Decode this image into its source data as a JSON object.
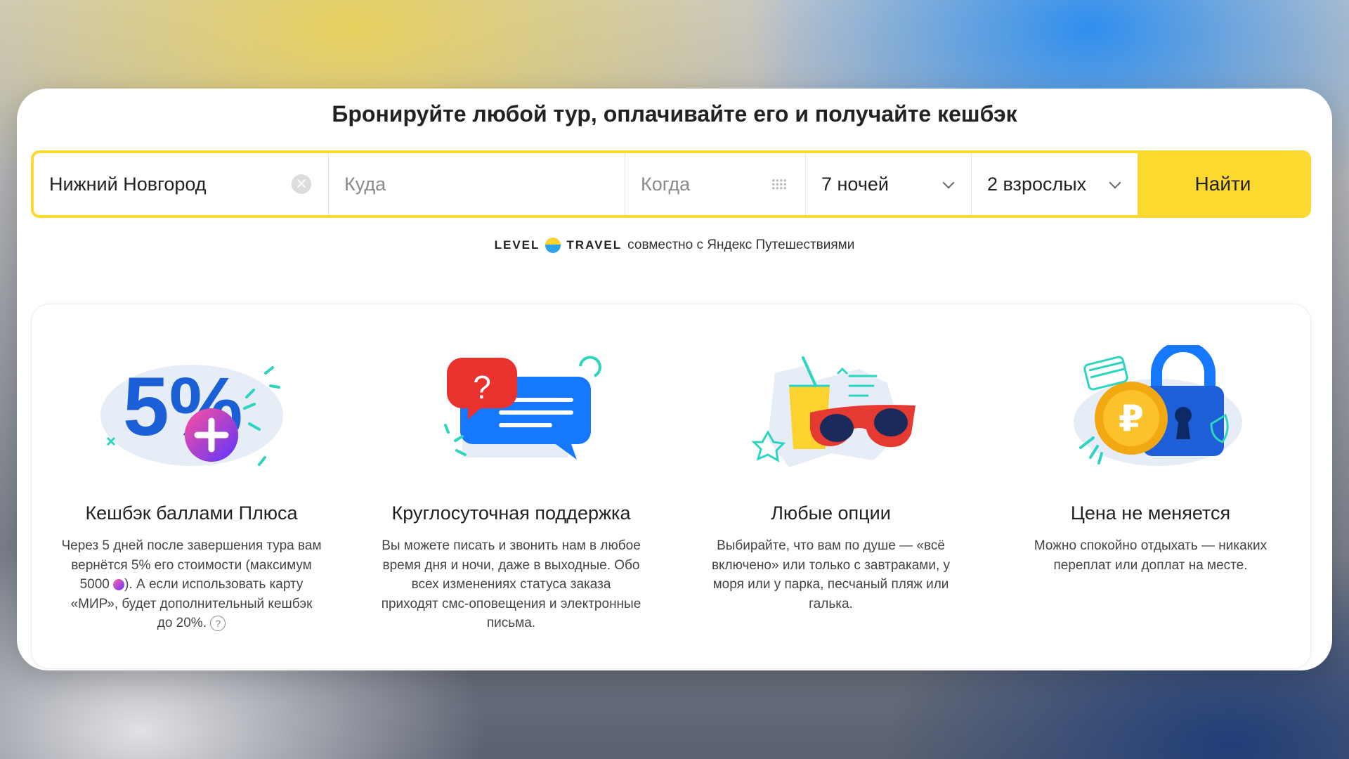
{
  "headline": "Бронируйте любой тур, оплачивайте его и получайте кешбэк",
  "search": {
    "from_value": "Нижний Новгород",
    "to_placeholder": "Куда",
    "when_placeholder": "Когда",
    "nights": "7 ночей",
    "guests": "2 взрослых",
    "find_label": "Найти",
    "icons": [
      "clear-icon",
      "calendar-icon",
      "chevron-down-icon"
    ]
  },
  "partner": {
    "brand_left": "LEVEL",
    "brand_right": "TRAVEL",
    "text": "совместно с Яндекс Путешествиями"
  },
  "features": [
    {
      "title": "Кешбэк баллами Плюса",
      "text_before": "Через 5 дней после завершения тура вам вернётся 5% его стоимости (максимум 5000",
      "text_after": "). А если использовать карту «МИР», будет дополнительный кешбэк до 20%.",
      "art_label": "5%",
      "help_icon": "?"
    },
    {
      "title": "Круглосуточная поддержка",
      "text": "Вы можете писать и звонить нам в любое время дня и ночи, даже в выходные. Обо всех изменениях статуса заказа приходят смс-оповещения и электронные письма.",
      "art_label": "?"
    },
    {
      "title": "Любые опции",
      "text": "Выбирайте, что вам по душе — «всё включено» или только с завтраками, у моря или у парка, песчаный пляж или галька."
    },
    {
      "title": "Цена не меняется",
      "text": "Можно спокойно отдыхать — никаких переплат или доплат на месте.",
      "art_label": "₽"
    }
  ],
  "colors": {
    "accent_yellow": "#fcd92f",
    "text_dark": "#222222",
    "placeholder": "#8a8a8a"
  }
}
